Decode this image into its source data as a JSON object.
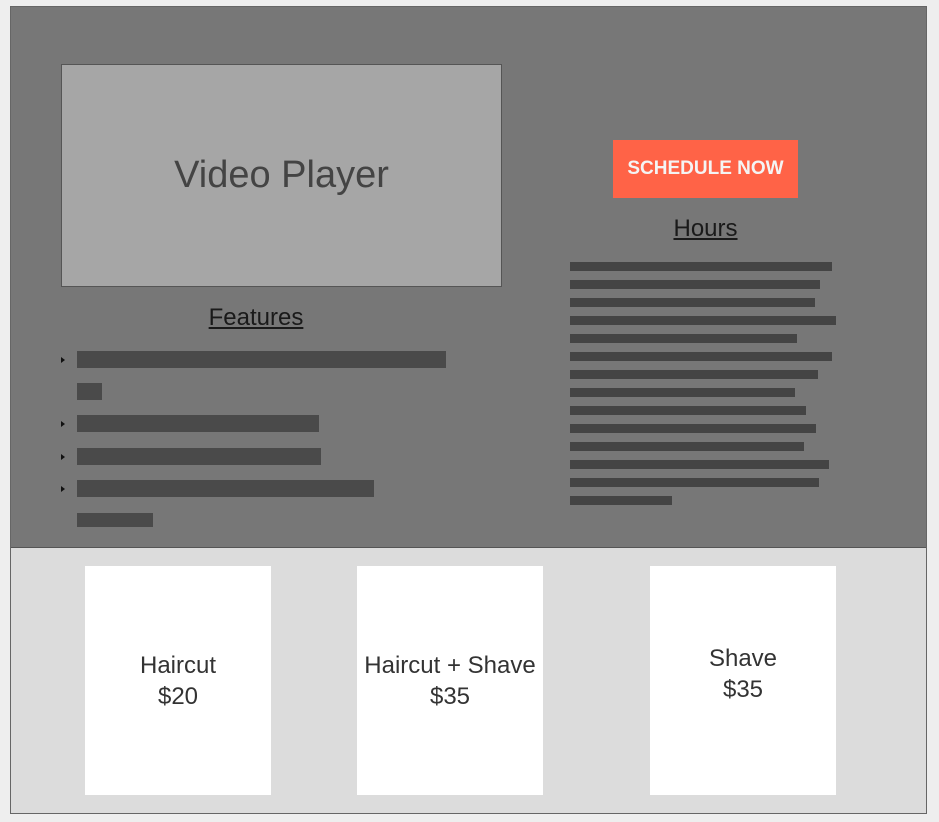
{
  "hero": {
    "video_label": "Video Player",
    "features_title": "Features",
    "schedule_button": "SCHEDULE NOW",
    "hours_title": "Hours"
  },
  "services": [
    {
      "name": "Haircut",
      "price": "$20"
    },
    {
      "name": "Haircut + Shave",
      "price": "$35"
    },
    {
      "name": "Shave",
      "price": "$35"
    }
  ],
  "colors": {
    "hero_bg": "#777777",
    "video_bg": "#a6a6a6",
    "accent_button": "#ff6347",
    "footer_bg": "#dcdcdc",
    "placeholder_text_bar": "#444444"
  }
}
